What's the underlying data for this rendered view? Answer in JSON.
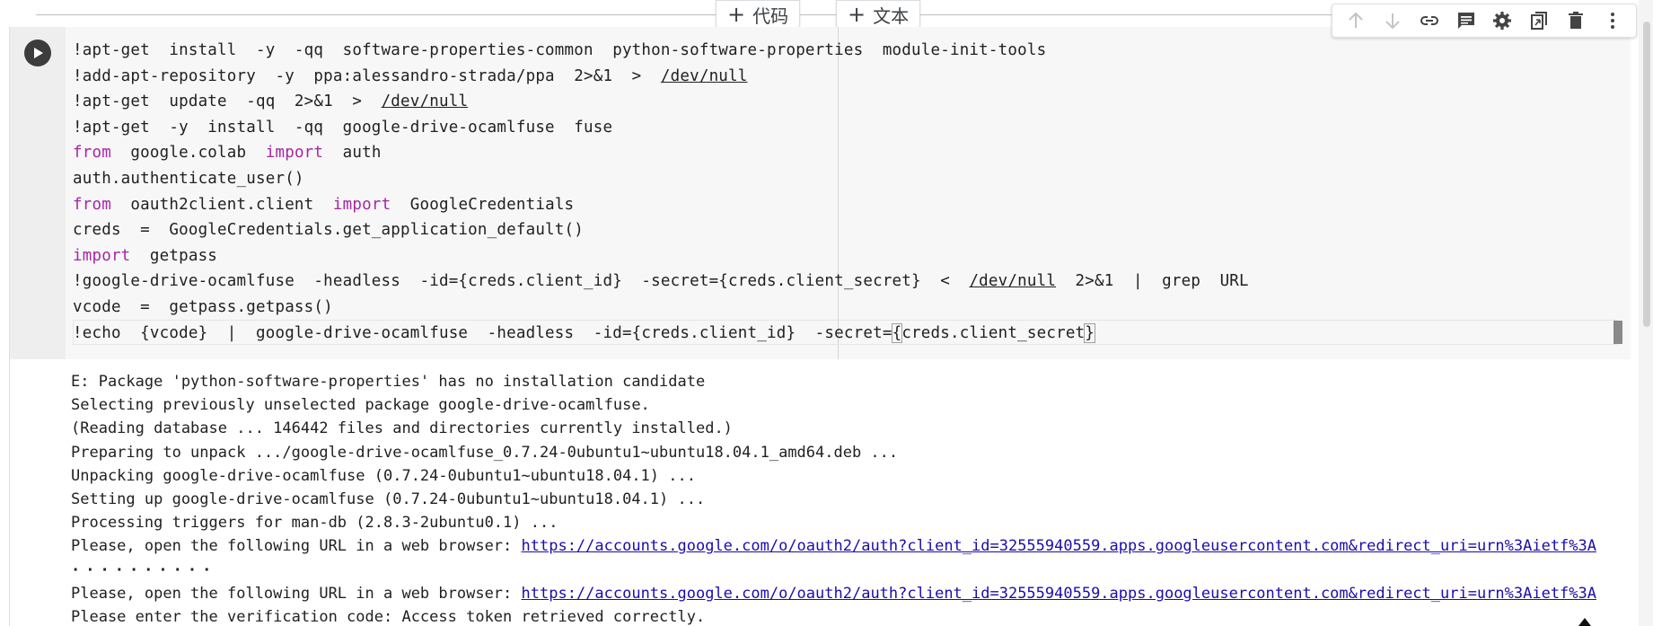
{
  "insert_buttons": {
    "code_label": "代码",
    "text_label": "文本"
  },
  "toolbar": {
    "icons": [
      "arrow-up-icon",
      "arrow-down-icon",
      "link-icon",
      "comment-icon",
      "gear-icon",
      "mirror-cell-icon",
      "delete-icon",
      "more-vert-icon"
    ]
  },
  "code": {
    "line1": "!apt-get  install  -y  -qq  software-properties-common  python-software-properties  module-init-tools",
    "line2_a": "!add-apt-repository  -y  ppa:alessandro-strada/ppa  2>&1  >  ",
    "line2_path": "/dev/null",
    "line3_a": "!apt-get  update  -qq  2>&1  >  ",
    "line3_path": "/dev/null",
    "line4": "!apt-get  -y  install  -qq  google-drive-ocamlfuse  fuse",
    "line5_kw1": "from",
    "line5_mid": "  google.colab  ",
    "line5_kw2": "import",
    "line5_end": "  auth",
    "line6": "auth.authenticate_user()",
    "line7_kw1": "from",
    "line7_mid": "  oauth2client.client  ",
    "line7_kw2": "import",
    "line7_end": "  GoogleCredentials",
    "line8": "creds  =  GoogleCredentials.get_application_default()",
    "line9_kw": "import",
    "line9_end": "  getpass",
    "line10_a": "!google-drive-ocamlfuse  -headless  -id={creds.client_id}  -secret={creds.client_secret}  <  ",
    "line10_path": "/dev/null",
    "line10_b": "  2>&1  |  grep  URL",
    "line11": "vcode  =  getpass.getpass()",
    "line12_a": "!echo  {vcode}  |  google-drive-ocamlfuse  -headless  -id={creds.client_id}  -secret=",
    "line12_brace": "{",
    "line12_b": "creds.client_secret",
    "line12_brace2": "}"
  },
  "output": {
    "l1": "E: Package 'python-software-properties' has no installation candidate",
    "l2": "Selecting previously unselected package google-drive-ocamlfuse.",
    "l3": "(Reading database ... 146442 files and directories currently installed.)",
    "l4": "Preparing to unpack .../google-drive-ocamlfuse_0.7.24-0ubuntu1~ubuntu18.04.1_amd64.deb ...",
    "l5": "Unpacking google-drive-ocamlfuse (0.7.24-0ubuntu1~ubuntu18.04.1) ...",
    "l6": "Setting up google-drive-ocamlfuse (0.7.24-0ubuntu1~ubuntu18.04.1) ...",
    "l7": "Processing triggers for man-db (2.8.3-2ubuntu0.1) ...",
    "l8_text": "Please, open the following URL in a web browser: ",
    "l8_link": "https://accounts.google.com/o/oauth2/auth?client_id=32555940559.apps.googleusercontent.com&redirect_uri=urn%3Aietf%3A",
    "l9_dots": "··········",
    "l10_text": "Please, open the following URL in a web browser: ",
    "l10_link": "https://accounts.google.com/o/oauth2/auth?client_id=32555940559.apps.googleusercontent.com&redirect_uri=urn%3Aietf%3A",
    "l11": "Please enter the verification code: Access token retrieved correctly."
  }
}
